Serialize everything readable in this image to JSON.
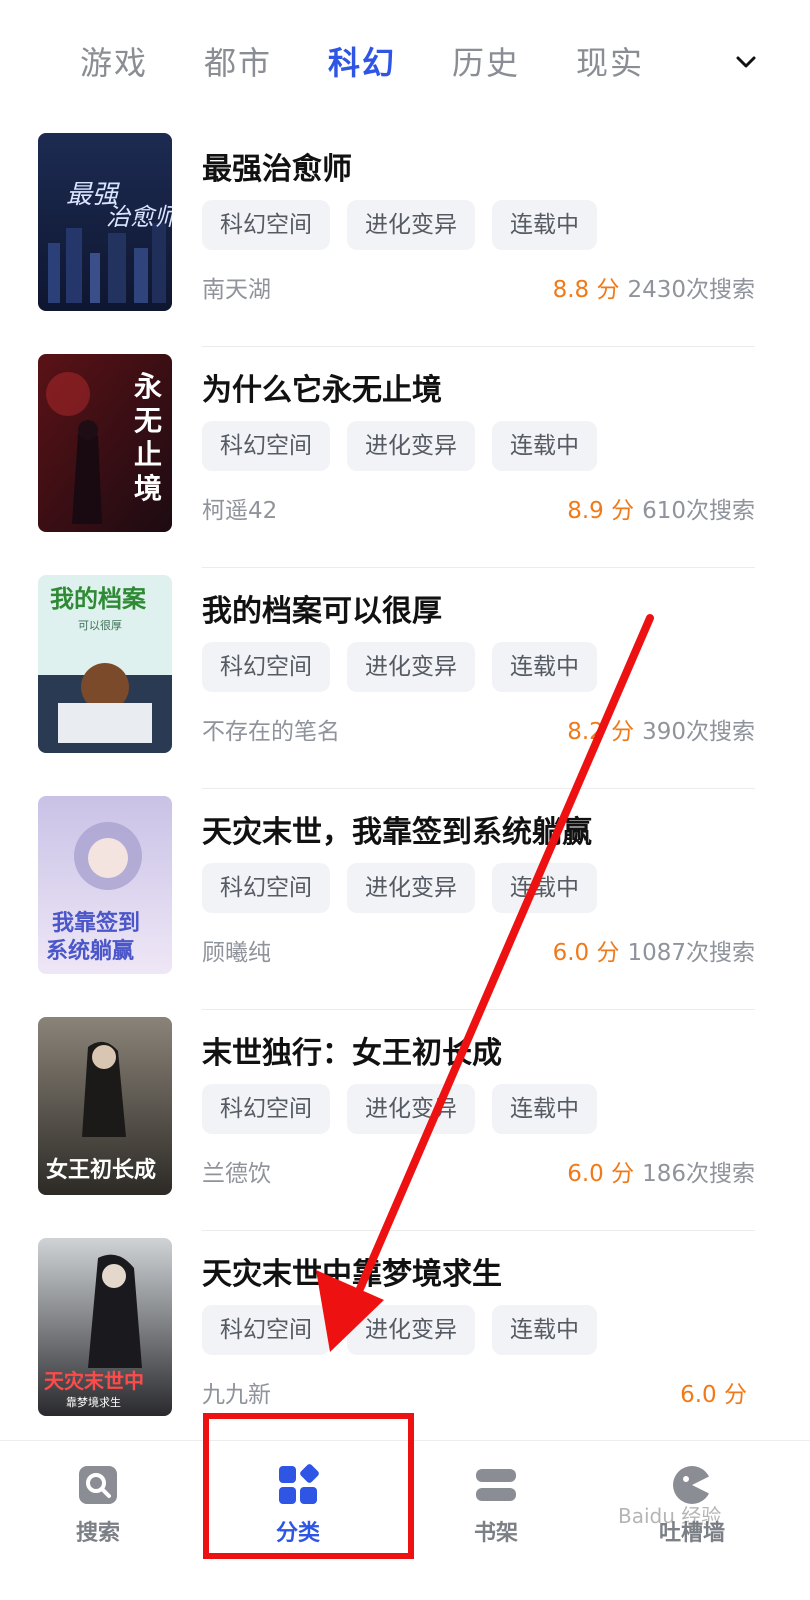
{
  "tabs": [
    {
      "label": "游戏"
    },
    {
      "label": "都市"
    },
    {
      "label": "科幻",
      "active": true
    },
    {
      "label": "历史"
    },
    {
      "label": "现实"
    }
  ],
  "books": [
    {
      "title": "最强治愈师",
      "tags": [
        "科幻空间",
        "进化变异",
        "连载中"
      ],
      "author": "南天湖",
      "score": "8.8 分",
      "searches": "2430次搜索",
      "cover_text": "最强治愈师"
    },
    {
      "title": "为什么它永无止境",
      "tags": [
        "科幻空间",
        "进化变异",
        "连载中"
      ],
      "author": "柯遥42",
      "score": "8.9 分",
      "searches": "610次搜索",
      "cover_text": "永无止境"
    },
    {
      "title": "我的档案可以很厚",
      "tags": [
        "科幻空间",
        "进化变异",
        "连载中"
      ],
      "author": "不存在的笔名",
      "score": "8.2 分",
      "searches": "390次搜索",
      "cover_text": "我的档案"
    },
    {
      "title": "天灾末世，我靠签到系统躺赢",
      "tags": [
        "科幻空间",
        "进化变异",
        "连载中"
      ],
      "author": "顾曦纯",
      "score": "6.0 分",
      "searches": "1087次搜索",
      "cover_text": "我靠签到系统躺赢"
    },
    {
      "title": "末世独行：女王初长成",
      "tags": [
        "科幻空间",
        "进化变异",
        "连载中"
      ],
      "author": "兰德饮",
      "score": "6.0 分",
      "searches": "186次搜索",
      "cover_text": "女王初长成"
    },
    {
      "title": "天灾末世中靠梦境求生",
      "tags": [
        "科幻空间",
        "进化变异",
        "连载中"
      ],
      "author": "九九新",
      "score": "6.0 分",
      "searches": "",
      "cover_text": "天灾末世中"
    }
  ],
  "bottom_nav": {
    "search": "搜索",
    "category": "分类",
    "shelf": "书架",
    "wall": "吐槽墙"
  },
  "watermark": "Baidu 经验",
  "colors": {
    "accent": "#2f55e4",
    "score": "#f07a1a",
    "annotation": "#ee1111"
  }
}
